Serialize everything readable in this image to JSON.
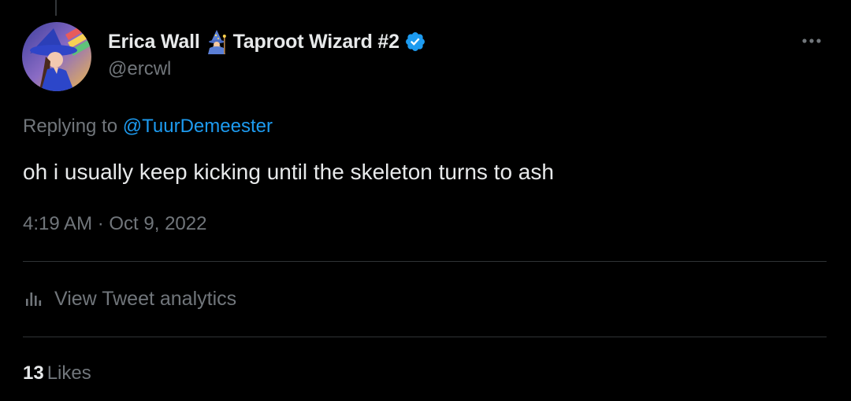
{
  "tweet": {
    "author": {
      "display_name": "Erica Wall",
      "name_suffix": "Taproot Wizard #2",
      "handle": "@ercwl",
      "verified": true
    },
    "reply_prefix": "Replying to ",
    "reply_to": "@TuurDemeester",
    "text": "oh i usually keep kicking until the skeleton turns to ash",
    "timestamp": "4:19 AM · Oct 9, 2022",
    "analytics_label": "View Tweet analytics",
    "likes_count": "13",
    "likes_label": "Likes"
  },
  "icons": {
    "more": "more-horizontal-icon",
    "verified": "verified-badge-icon",
    "wizard": "mage-emoji-icon",
    "analytics": "bar-chart-icon"
  },
  "colors": {
    "background": "#000000",
    "text_primary": "#e7e9ea",
    "text_secondary": "#71767b",
    "link": "#1d9bf0",
    "verified": "#1d9bf0",
    "divider": "#2f3336"
  }
}
